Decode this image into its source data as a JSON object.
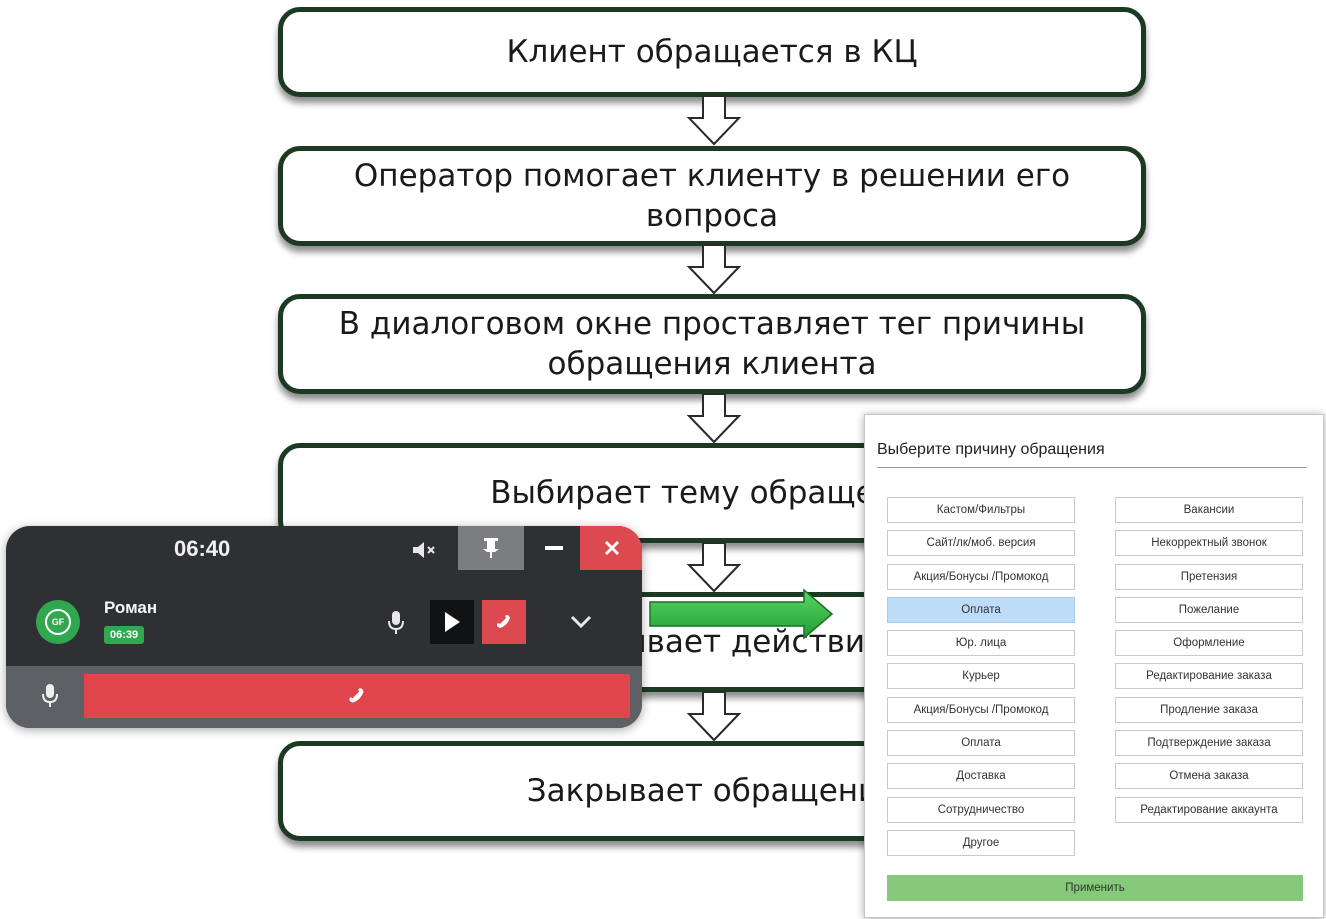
{
  "flow": {
    "steps": [
      "Клиент обращается в КЦ",
      "Оператор помогает клиенту в решении его вопроса",
      "В диалоговом окне проставляет тег причины обращения клиента",
      "Выбирает тему обращения",
      "Описывает действия",
      "Закрывает обращение"
    ]
  },
  "phone": {
    "timer": "06:40",
    "caller_name": "Роман",
    "call_duration": "06:39",
    "avatar_text": "GF",
    "colors": {
      "panel": "#2e3034",
      "hangup": "#dc4a4f",
      "accent": "#2fa84e"
    }
  },
  "dialog": {
    "title": "Выберите причину обращения",
    "left_items": [
      "Кастом/Фильтры",
      "Сайт/лк/моб. версия",
      "Акция/Бонусы /Промокод",
      "Оплата",
      "Юр. лица",
      "Курьер",
      "Акция/Бонусы /Промокод",
      "Оплата",
      "Доставка",
      "Сотрудничество",
      "Другое"
    ],
    "right_items": [
      "Вакансии",
      "Некорректный звонок",
      "Претензия",
      "Пожелание",
      "Оформление",
      "Редактирование заказа",
      "Продление заказа",
      "Подтверждение заказа",
      "Отмена заказа",
      "Редактирование аккаунта"
    ],
    "selected_item": "Оплата",
    "apply_label": "Применить",
    "colors": {
      "selected": "#bcdcf8",
      "apply": "#86c97a"
    }
  }
}
